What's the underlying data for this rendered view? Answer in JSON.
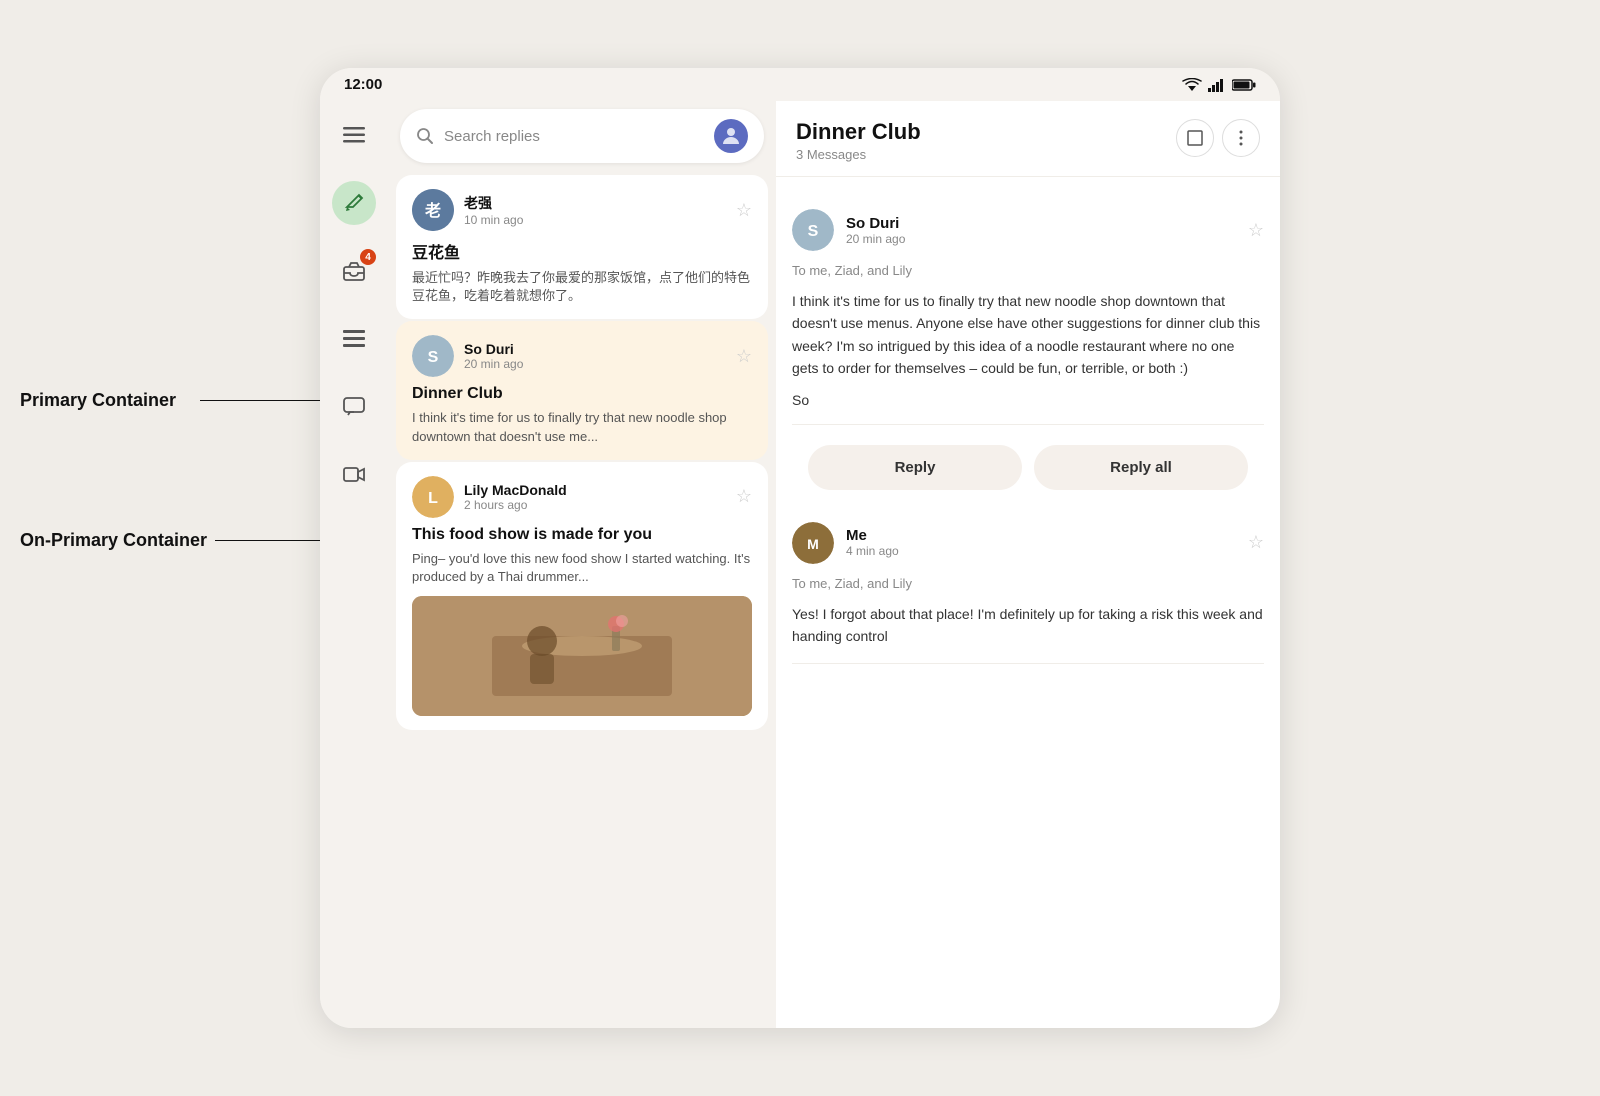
{
  "status_bar": {
    "time": "12:00",
    "icons": [
      "wifi",
      "signal",
      "battery"
    ]
  },
  "sidebar": {
    "icons": [
      {
        "name": "menu-icon",
        "symbol": "☰",
        "label": "Menu"
      },
      {
        "name": "compose-icon",
        "symbol": "✏",
        "label": "Compose",
        "class": "compose"
      },
      {
        "name": "inbox-icon",
        "symbol": "🖼",
        "label": "Inbox",
        "badge": "4"
      },
      {
        "name": "list-icon",
        "symbol": "☰",
        "label": "List"
      },
      {
        "name": "chat-icon",
        "symbol": "☐",
        "label": "Chat"
      },
      {
        "name": "video-icon",
        "symbol": "🎬",
        "label": "Video"
      }
    ]
  },
  "search": {
    "placeholder": "Search replies"
  },
  "labels": {
    "primary_container": "Primary Container",
    "on_primary_container": "On-Primary Container"
  },
  "email_list": {
    "emails": [
      {
        "id": "email-1",
        "sender": "老强",
        "time": "10 min ago",
        "subject": "豆花鱼",
        "preview": "最近忙吗？昨晚我去了你最爱的那家饭馆，点了他们的特色豆花鱼，吃着吃着就想你了。",
        "avatar_color": "#5c7a9e",
        "avatar_initials": "老",
        "selected": false
      },
      {
        "id": "email-2",
        "sender": "So Duri",
        "time": "20 min ago",
        "subject": "Dinner Club",
        "preview": "I think it's time for us to finally try that new noodle shop downtown that doesn't use me...",
        "avatar_color": "#a0b8c8",
        "avatar_initials": "S",
        "selected": true
      },
      {
        "id": "email-3",
        "sender": "Lily MacDonald",
        "time": "2 hours ago",
        "subject": "This food show is made for you",
        "preview": "Ping– you'd love this new food show I started watching. It's produced by a Thai drummer...",
        "avatar_color": "#e0b060",
        "avatar_initials": "L",
        "selected": false,
        "has_image": true
      }
    ]
  },
  "email_detail": {
    "title": "Dinner Club",
    "count": "3 Messages",
    "messages": [
      {
        "id": "msg-1",
        "sender": "So Duri",
        "time": "20 min ago",
        "to": "To me, Ziad, and Lily",
        "body": "I think it's time for us to finally try that new noodle shop downtown that doesn't use menus. Anyone else have other suggestions for dinner club this week? I'm so intrigued by this idea of a noodle restaurant where no one gets to order for themselves – could be fun, or terrible, or both :)",
        "signature": "So",
        "avatar_color": "#a0b8c8",
        "avatar_initials": "S"
      },
      {
        "id": "msg-2",
        "sender": "Me",
        "time": "4 min ago",
        "to": "To me, Ziad, and Lily",
        "body": "Yes! I forgot about that place! I'm definitely up for taking a risk this week and handing control",
        "avatar_color": "#8d6e3a",
        "avatar_initials": "M"
      }
    ],
    "reply_button": "Reply",
    "reply_all_button": "Reply all"
  }
}
